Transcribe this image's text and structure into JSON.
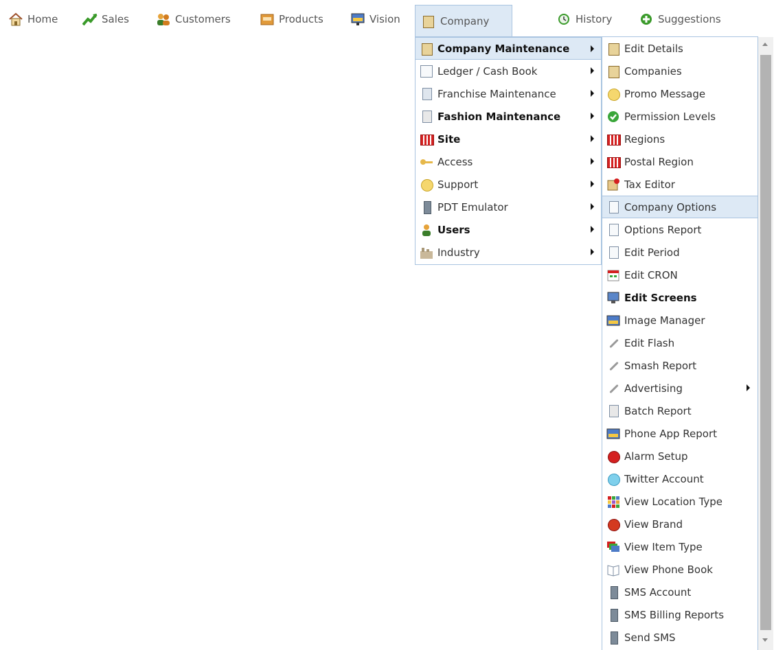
{
  "topnav": {
    "items": [
      {
        "label": "Home",
        "icon": "home-icon"
      },
      {
        "label": "Sales",
        "icon": "sales-chart-icon"
      },
      {
        "label": "Customers",
        "icon": "customers-icon"
      },
      {
        "label": "Products",
        "icon": "products-icon"
      },
      {
        "label": "Vision",
        "icon": "vision-icon"
      },
      {
        "label": "Company",
        "icon": "company-building-icon",
        "active": true
      },
      {
        "label": "History",
        "icon": "history-icon"
      },
      {
        "label": "Suggestions",
        "icon": "suggestions-icon"
      }
    ]
  },
  "company_menu": {
    "items": [
      {
        "label": "Company Maintenance",
        "bold": true,
        "active": true,
        "submenu": true,
        "icon": "building-icon"
      },
      {
        "label": "Ledger / Cash Book",
        "bold": false,
        "submenu": true,
        "icon": "ledger-icon"
      },
      {
        "label": "Franchise Maintenance",
        "bold": false,
        "submenu": true,
        "icon": "franchise-icon"
      },
      {
        "label": "Fashion Maintenance",
        "bold": true,
        "submenu": true,
        "icon": "fashion-icon"
      },
      {
        "label": "Site",
        "bold": true,
        "submenu": true,
        "icon": "store-icon"
      },
      {
        "label": "Access",
        "bold": false,
        "submenu": true,
        "icon": "key-icon"
      },
      {
        "label": "Support",
        "bold": false,
        "submenu": true,
        "icon": "support-icon"
      },
      {
        "label": "PDT Emulator",
        "bold": false,
        "submenu": true,
        "icon": "device-icon"
      },
      {
        "label": "Users",
        "bold": true,
        "submenu": true,
        "icon": "user-icon"
      },
      {
        "label": "Industry",
        "bold": false,
        "submenu": true,
        "icon": "industry-icon"
      }
    ]
  },
  "maintenance_submenu": {
    "items": [
      {
        "label": "Edit Details",
        "icon": "edit-details-icon"
      },
      {
        "label": "Companies",
        "icon": "building-icon"
      },
      {
        "label": "Promo Message",
        "icon": "promo-icon"
      },
      {
        "label": "Permission Levels",
        "icon": "check-icon"
      },
      {
        "label": "Regions",
        "icon": "store-icon"
      },
      {
        "label": "Postal Region",
        "icon": "store-icon"
      },
      {
        "label": "Tax Editor",
        "icon": "tax-icon"
      },
      {
        "label": "Company Options",
        "icon": "document-icon",
        "active": true
      },
      {
        "label": "Options Report",
        "icon": "document-icon"
      },
      {
        "label": "Edit Period",
        "icon": "document-icon"
      },
      {
        "label": "Edit CRON",
        "icon": "calendar-icon"
      },
      {
        "label": "Edit Screens",
        "icon": "screen-icon",
        "bold": true
      },
      {
        "label": "Image Manager",
        "icon": "image-icon"
      },
      {
        "label": "Edit Flash",
        "icon": "wrench-icon"
      },
      {
        "label": "Smash Report",
        "icon": "wrench-icon"
      },
      {
        "label": "Advertising",
        "icon": "wrench-icon",
        "submenu": true
      },
      {
        "label": "Batch Report",
        "icon": "batch-icon"
      },
      {
        "label": "Phone App Report",
        "icon": "phone-app-icon"
      },
      {
        "label": "Alarm Setup",
        "icon": "alarm-icon"
      },
      {
        "label": "Twitter Account",
        "icon": "speech-bubble-icon"
      },
      {
        "label": "View Location Type",
        "icon": "grid-icon"
      },
      {
        "label": "View Brand",
        "icon": "apple-icon"
      },
      {
        "label": "View Item Type",
        "icon": "layers-icon"
      },
      {
        "label": "View Phone Book",
        "icon": "book-icon"
      },
      {
        "label": "SMS Account",
        "icon": "phone-icon"
      },
      {
        "label": "SMS Billing Reports",
        "icon": "phone-icon"
      },
      {
        "label": "Send SMS",
        "icon": "phone-icon"
      }
    ]
  }
}
